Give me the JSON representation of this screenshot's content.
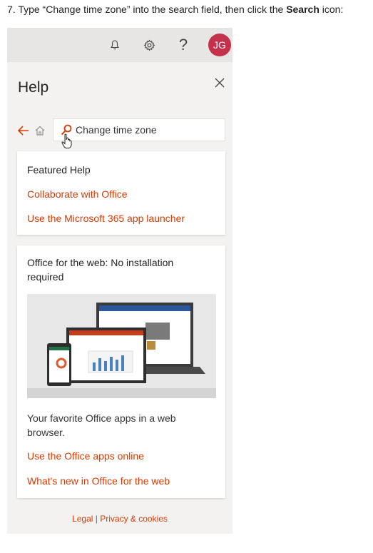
{
  "instruction": {
    "prefix": "7. Type “Change time zone” into the search field, then click the ",
    "bold": "Search",
    "suffix": " icon:"
  },
  "topbar": {
    "avatar_initials": "JG",
    "help_glyph": "?"
  },
  "help": {
    "title": "Help",
    "search_value": "Change time zone"
  },
  "featured": {
    "heading": "Featured Help",
    "links": [
      "Collaborate with Office",
      "Use the Microsoft 365 app launcher"
    ]
  },
  "office_card": {
    "heading": "Office for the web: No installation required",
    "description": "Your favorite Office apps in a web browser.",
    "links": [
      "Use the Office apps online",
      "What's new in Office for the web"
    ]
  },
  "footer": {
    "legal": "Legal",
    "separator": "|",
    "privacy": "Privacy & cookies"
  },
  "colors": {
    "accent": "#d83b01",
    "avatar_bg": "#c4314b",
    "panel_bg": "#f3f2f1"
  },
  "icons": [
    "bell-icon",
    "gear-icon",
    "help-icon",
    "close-icon",
    "back-arrow-icon",
    "home-icon",
    "search-icon",
    "hand-cursor-icon"
  ]
}
